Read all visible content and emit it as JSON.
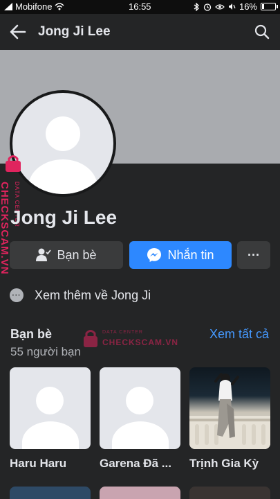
{
  "status_bar": {
    "carrier": "Mobifone",
    "time": "16:55",
    "battery": "16%",
    "battery_level": 0.16
  },
  "app_bar": {
    "title": "Jong Ji Lee"
  },
  "profile": {
    "name": "Jong Ji Lee"
  },
  "actions": {
    "friends_label": "Bạn bè",
    "message_label": "Nhắn tin",
    "more_label": "···"
  },
  "see_more": {
    "icon_text": "···",
    "label": "Xem thêm về Jong Ji"
  },
  "friends": {
    "title": "Bạn bè",
    "count": "55 người bạn",
    "see_all": "Xem tất cả",
    "items": [
      {
        "name": "Haru Haru",
        "photo": "default-avatar"
      },
      {
        "name": "Garena Đã ...",
        "photo": "default-avatar"
      },
      {
        "name": "Trịnh Gia Kỳ",
        "photo": "photo"
      }
    ]
  },
  "watermark": {
    "brand": "CHECKSCAM.VN",
    "caption": "DATA CENTER"
  },
  "colors": {
    "background": "#242526",
    "accent": "#2d88ff",
    "link": "#4599ff",
    "watermark": "#e0245e"
  }
}
